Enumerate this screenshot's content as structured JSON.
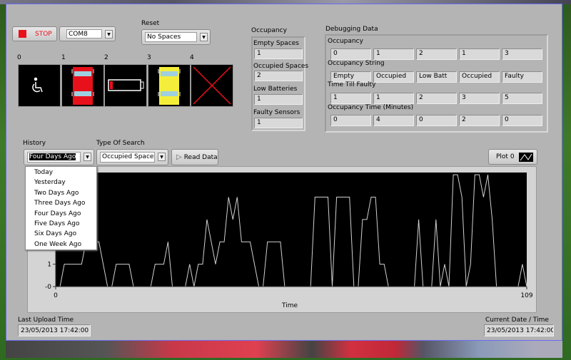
{
  "controls": {
    "stop_label": "STOP",
    "com_port": "COM8",
    "reset_label": "Reset",
    "reset_value": "No Spaces"
  },
  "spaces": {
    "indices": [
      "0",
      "1",
      "2",
      "3",
      "4"
    ],
    "icons": [
      "wheelchair-icon",
      "red-car-icon",
      "low-battery-icon",
      "yellow-car-icon",
      "red-x-icon"
    ]
  },
  "occupancy": {
    "title": "Occupancy",
    "items": [
      {
        "label": "Empty Spaces",
        "value": "1"
      },
      {
        "label": "Occupied Spaces",
        "value": "2"
      },
      {
        "label": "Low Batteries",
        "value": "1"
      },
      {
        "label": "Faulty Sensors",
        "value": "1"
      }
    ]
  },
  "debug": {
    "title": "Debugging Data",
    "rows": [
      {
        "label": "Occupancy",
        "values": [
          "0",
          "1",
          "2",
          "1",
          "3"
        ]
      },
      {
        "label": "Occupancy String",
        "values": [
          "Empty",
          "Occupied",
          "Low Batt",
          "Occupied",
          "Faulty"
        ]
      },
      {
        "label": "Time Till Faulty",
        "values": [
          "1",
          "1",
          "2",
          "3",
          "5"
        ]
      },
      {
        "label": "Occupancy Time (Minutes)",
        "values": [
          "0",
          "4",
          "0",
          "2",
          "0"
        ]
      }
    ]
  },
  "history": {
    "label": "History",
    "value": "Four Days Ago",
    "options": [
      "Today",
      "Yesterday",
      "Two Days Ago",
      "Three Days Ago",
      "Four Days Ago",
      "Five Days Ago",
      "Six Days Ago",
      "One Week Ago"
    ]
  },
  "search": {
    "label": "Type Of Search",
    "value": "Occupied Spaces",
    "read_label": "Read Data"
  },
  "legend": {
    "plot_label": "Plot 0"
  },
  "chart_data": {
    "type": "line",
    "xlabel": "Time",
    "ylabel": "",
    "xlim": [
      0,
      109
    ],
    "ylim": [
      0,
      5.1
    ],
    "x_ticks": [
      "0",
      "109"
    ],
    "y_ticks": [
      "-0",
      "1"
    ],
    "grid": false,
    "line_color": "#d0d0d0",
    "background": "#000000",
    "values": [
      0,
      0,
      1,
      1,
      1,
      1,
      1,
      2,
      2,
      2,
      2,
      1,
      0,
      0,
      1,
      1,
      1,
      1,
      0,
      0,
      0,
      0,
      0,
      1,
      1,
      1,
      2,
      0,
      0,
      0,
      0,
      1,
      0,
      1,
      1,
      3,
      2,
      1,
      2,
      2,
      4,
      3,
      4,
      2,
      2,
      2,
      1,
      0,
      0,
      2,
      2,
      2,
      2,
      0,
      0,
      0,
      0,
      0,
      0,
      0,
      4,
      4,
      4,
      4,
      0,
      4,
      4,
      4,
      4,
      0,
      0,
      3,
      3,
      4,
      4,
      1,
      1,
      0,
      0,
      0,
      0,
      0,
      0,
      0,
      3,
      0,
      0,
      0,
      3,
      0,
      1,
      0,
      5,
      5,
      4,
      0,
      1,
      5,
      5,
      4,
      5,
      3,
      0,
      0,
      0,
      0,
      0,
      0,
      1,
      0
    ]
  },
  "footer": {
    "last_upload_label": "Last Upload Time",
    "last_upload_value": "23/05/2013 17:42:00",
    "current_label": "Current Date / Time",
    "current_value": "23/05/2013 17:42:00"
  }
}
